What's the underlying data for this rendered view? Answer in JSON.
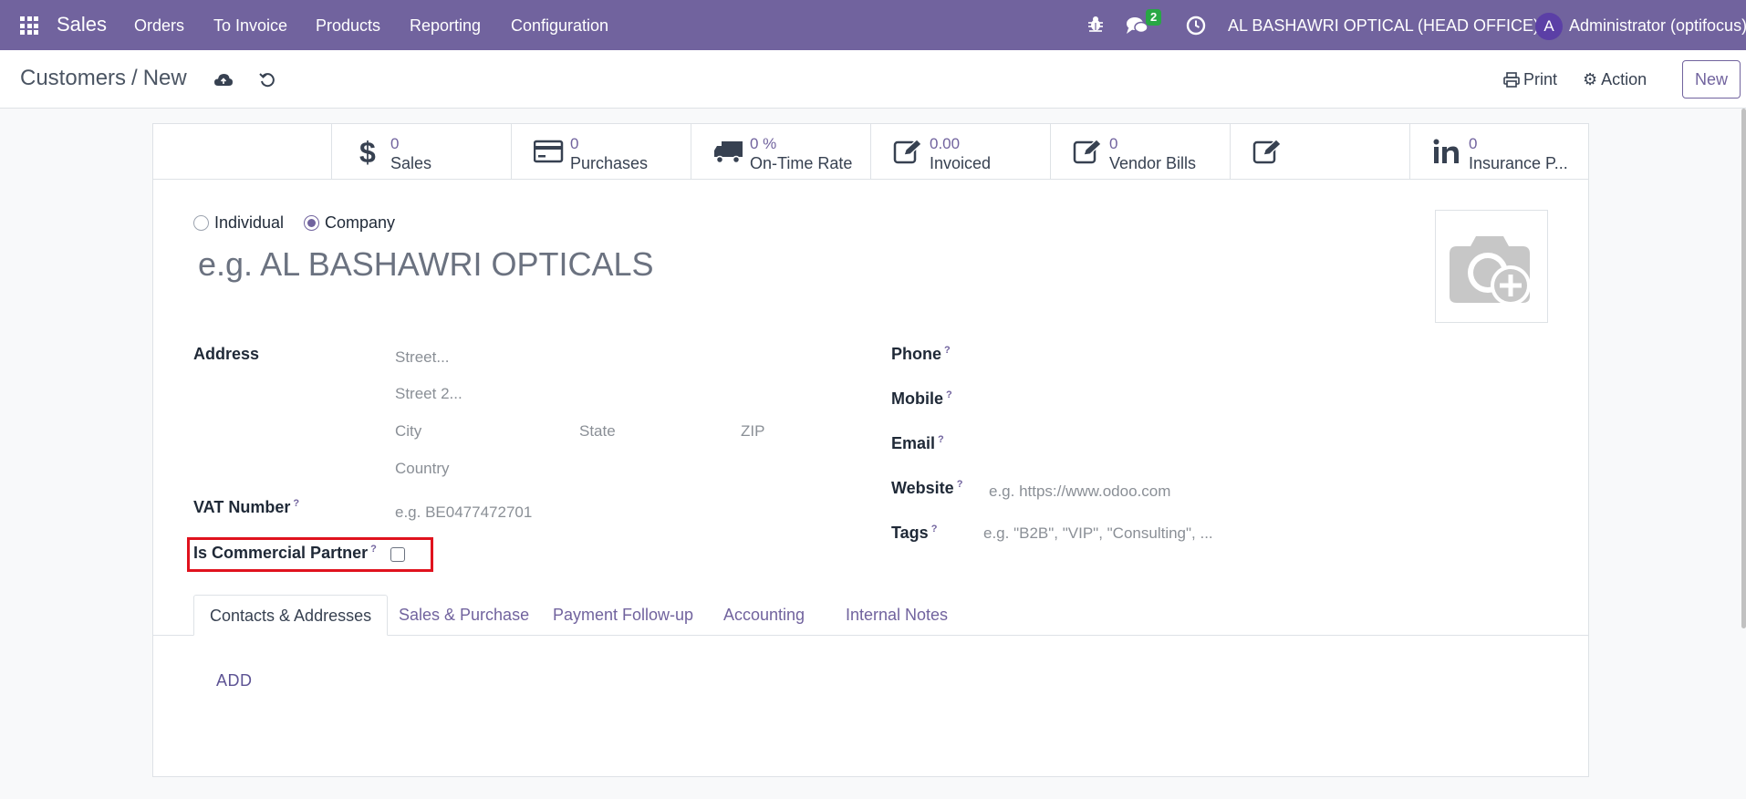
{
  "navbar": {
    "brand": "Sales",
    "menu": [
      "Orders",
      "To Invoice",
      "Products",
      "Reporting",
      "Configuration"
    ],
    "message_count": "2",
    "company": "AL BASHAWRI OPTICAL (HEAD OFFICE)",
    "avatar_initial": "A",
    "user": "Administrator (optifocus)",
    "icons": [
      "apps-icon",
      "bug-icon",
      "chat-icon",
      "clock-icon"
    ],
    "color": "#71639e"
  },
  "control_panel": {
    "breadcrumb_parent": "Customers",
    "breadcrumb_separator": "/",
    "breadcrumb_current": "New",
    "print_label": "Print",
    "action_label": "Action",
    "new_label": "New",
    "icons": [
      "cloud-save-icon",
      "discard-icon",
      "printer-icon",
      "gear-icon"
    ]
  },
  "stat_buttons": [
    {
      "value": "0",
      "label": "Sales",
      "icon": "dollar-icon"
    },
    {
      "value": "0",
      "label": "Purchases",
      "icon": "credit-card-icon"
    },
    {
      "value": "0 %",
      "label": "On-Time Rate",
      "icon": "truck-icon"
    },
    {
      "value": "0.00",
      "label": "Invoiced",
      "icon": "edit-icon"
    },
    {
      "value": "0",
      "label": "Vendor Bills",
      "icon": "edit-icon"
    },
    {
      "value": "",
      "label": "",
      "icon": "edit-icon"
    },
    {
      "value": "0",
      "label": "Insurance P...",
      "icon": "linkedin-icon"
    }
  ],
  "form": {
    "type_individual": "Individual",
    "type_company": "Company",
    "selected_type": "Company",
    "name_placeholder": "e.g. AL BASHAWRI OPTICALS",
    "address_label": "Address",
    "street_placeholder": "Street...",
    "street2_placeholder": "Street 2...",
    "city_placeholder": "City",
    "state_placeholder": "State",
    "zip_placeholder": "ZIP",
    "country_placeholder": "Country",
    "vat_label": "VAT Number",
    "vat_placeholder": "e.g. BE0477472701",
    "commercial_label": "Is Commercial Partner",
    "commercial_checked": false,
    "phone_label": "Phone",
    "mobile_label": "Mobile",
    "email_label": "Email",
    "website_label": "Website",
    "website_placeholder": "e.g. https://www.odoo.com",
    "tags_label": "Tags",
    "tags_placeholder": "e.g. \"B2B\", \"VIP\", \"Consulting\", ...",
    "help_mark": "?",
    "highlight_color": "#e0121e"
  },
  "tabs": [
    "Contacts & Addresses",
    "Sales & Purchase",
    "Payment Follow-up",
    "Accounting",
    "Internal Notes"
  ],
  "active_tab": "Contacts & Addresses",
  "contacts": {
    "add_label": "ADD"
  }
}
